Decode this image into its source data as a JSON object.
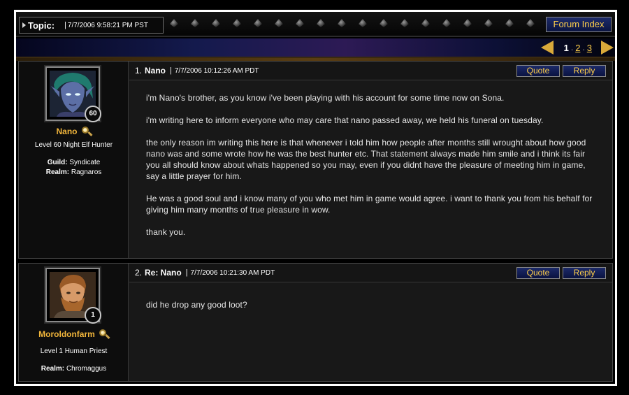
{
  "topic": {
    "label": "Topic:",
    "separator": "|",
    "date": "7/7/2006 9:58:21 PM PST"
  },
  "nav": {
    "forum_index": "Forum Index"
  },
  "pagination": {
    "current": "1",
    "pages": [
      "2",
      "3"
    ]
  },
  "posts": [
    {
      "number": "1.",
      "title": "Nano",
      "separator": "|",
      "date": "7/7/2006 10:12:26 AM PDT",
      "quote_label": "Quote",
      "reply_label": "Reply",
      "author": {
        "name": "Nano",
        "level_badge": "60",
        "class_line": "Level 60 Night Elf Hunter",
        "guild_label": "Guild:",
        "guild": "Syndicate",
        "realm_label": "Realm:",
        "realm": "Ragnaros"
      },
      "paragraphs": [
        "i'm Nano's brother, as you know i've been playing with his account for some time now on Sona.",
        "i'm writing here to inform everyone who may care that nano passed away, we held his funeral on tuesday.",
        "the only reason im writing this here is that whenever i told him how people after months still wrought about how good nano was and some wrote how he was the best hunter etc. That statement always made him smile and i think its fair you all should know about whats happened so you may, even if you didnt have the pleasure of meeting him in game, say a little prayer for him.",
        "He was a good soul and i know many of you who met him in game would agree. i want to thank you from his behalf for giving him many months of true pleasure in wow.",
        "thank you."
      ]
    },
    {
      "number": "2.",
      "title": "Re: Nano",
      "separator": "|",
      "date": "7/7/2006 10:21:30 AM PDT",
      "quote_label": "Quote",
      "reply_label": "Reply",
      "author": {
        "name": "Moroldonfarm",
        "level_badge": "1",
        "class_line": "Level 1 Human Priest",
        "realm_label": "Realm:",
        "realm": "Chromaggus"
      },
      "paragraphs": [
        "did he drop any good loot?"
      ]
    }
  ]
}
